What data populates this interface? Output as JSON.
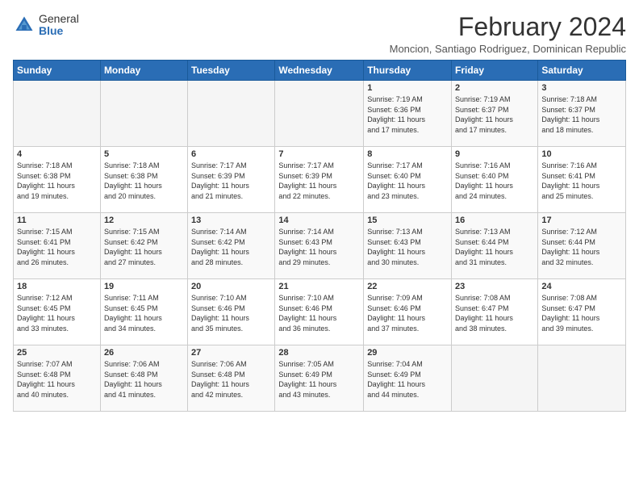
{
  "logo": {
    "general": "General",
    "blue": "Blue"
  },
  "header": {
    "month_year": "February 2024",
    "location": "Moncion, Santiago Rodriguez, Dominican Republic"
  },
  "days_of_week": [
    "Sunday",
    "Monday",
    "Tuesday",
    "Wednesday",
    "Thursday",
    "Friday",
    "Saturday"
  ],
  "weeks": [
    [
      {
        "day": "",
        "info": ""
      },
      {
        "day": "",
        "info": ""
      },
      {
        "day": "",
        "info": ""
      },
      {
        "day": "",
        "info": ""
      },
      {
        "day": "1",
        "info": "Sunrise: 7:19 AM\nSunset: 6:36 PM\nDaylight: 11 hours\nand 17 minutes."
      },
      {
        "day": "2",
        "info": "Sunrise: 7:19 AM\nSunset: 6:37 PM\nDaylight: 11 hours\nand 17 minutes."
      },
      {
        "day": "3",
        "info": "Sunrise: 7:18 AM\nSunset: 6:37 PM\nDaylight: 11 hours\nand 18 minutes."
      }
    ],
    [
      {
        "day": "4",
        "info": "Sunrise: 7:18 AM\nSunset: 6:38 PM\nDaylight: 11 hours\nand 19 minutes."
      },
      {
        "day": "5",
        "info": "Sunrise: 7:18 AM\nSunset: 6:38 PM\nDaylight: 11 hours\nand 20 minutes."
      },
      {
        "day": "6",
        "info": "Sunrise: 7:17 AM\nSunset: 6:39 PM\nDaylight: 11 hours\nand 21 minutes."
      },
      {
        "day": "7",
        "info": "Sunrise: 7:17 AM\nSunset: 6:39 PM\nDaylight: 11 hours\nand 22 minutes."
      },
      {
        "day": "8",
        "info": "Sunrise: 7:17 AM\nSunset: 6:40 PM\nDaylight: 11 hours\nand 23 minutes."
      },
      {
        "day": "9",
        "info": "Sunrise: 7:16 AM\nSunset: 6:40 PM\nDaylight: 11 hours\nand 24 minutes."
      },
      {
        "day": "10",
        "info": "Sunrise: 7:16 AM\nSunset: 6:41 PM\nDaylight: 11 hours\nand 25 minutes."
      }
    ],
    [
      {
        "day": "11",
        "info": "Sunrise: 7:15 AM\nSunset: 6:41 PM\nDaylight: 11 hours\nand 26 minutes."
      },
      {
        "day": "12",
        "info": "Sunrise: 7:15 AM\nSunset: 6:42 PM\nDaylight: 11 hours\nand 27 minutes."
      },
      {
        "day": "13",
        "info": "Sunrise: 7:14 AM\nSunset: 6:42 PM\nDaylight: 11 hours\nand 28 minutes."
      },
      {
        "day": "14",
        "info": "Sunrise: 7:14 AM\nSunset: 6:43 PM\nDaylight: 11 hours\nand 29 minutes."
      },
      {
        "day": "15",
        "info": "Sunrise: 7:13 AM\nSunset: 6:43 PM\nDaylight: 11 hours\nand 30 minutes."
      },
      {
        "day": "16",
        "info": "Sunrise: 7:13 AM\nSunset: 6:44 PM\nDaylight: 11 hours\nand 31 minutes."
      },
      {
        "day": "17",
        "info": "Sunrise: 7:12 AM\nSunset: 6:44 PM\nDaylight: 11 hours\nand 32 minutes."
      }
    ],
    [
      {
        "day": "18",
        "info": "Sunrise: 7:12 AM\nSunset: 6:45 PM\nDaylight: 11 hours\nand 33 minutes."
      },
      {
        "day": "19",
        "info": "Sunrise: 7:11 AM\nSunset: 6:45 PM\nDaylight: 11 hours\nand 34 minutes."
      },
      {
        "day": "20",
        "info": "Sunrise: 7:10 AM\nSunset: 6:46 PM\nDaylight: 11 hours\nand 35 minutes."
      },
      {
        "day": "21",
        "info": "Sunrise: 7:10 AM\nSunset: 6:46 PM\nDaylight: 11 hours\nand 36 minutes."
      },
      {
        "day": "22",
        "info": "Sunrise: 7:09 AM\nSunset: 6:46 PM\nDaylight: 11 hours\nand 37 minutes."
      },
      {
        "day": "23",
        "info": "Sunrise: 7:08 AM\nSunset: 6:47 PM\nDaylight: 11 hours\nand 38 minutes."
      },
      {
        "day": "24",
        "info": "Sunrise: 7:08 AM\nSunset: 6:47 PM\nDaylight: 11 hours\nand 39 minutes."
      }
    ],
    [
      {
        "day": "25",
        "info": "Sunrise: 7:07 AM\nSunset: 6:48 PM\nDaylight: 11 hours\nand 40 minutes."
      },
      {
        "day": "26",
        "info": "Sunrise: 7:06 AM\nSunset: 6:48 PM\nDaylight: 11 hours\nand 41 minutes."
      },
      {
        "day": "27",
        "info": "Sunrise: 7:06 AM\nSunset: 6:48 PM\nDaylight: 11 hours\nand 42 minutes."
      },
      {
        "day": "28",
        "info": "Sunrise: 7:05 AM\nSunset: 6:49 PM\nDaylight: 11 hours\nand 43 minutes."
      },
      {
        "day": "29",
        "info": "Sunrise: 7:04 AM\nSunset: 6:49 PM\nDaylight: 11 hours\nand 44 minutes."
      },
      {
        "day": "",
        "info": ""
      },
      {
        "day": "",
        "info": ""
      }
    ]
  ]
}
